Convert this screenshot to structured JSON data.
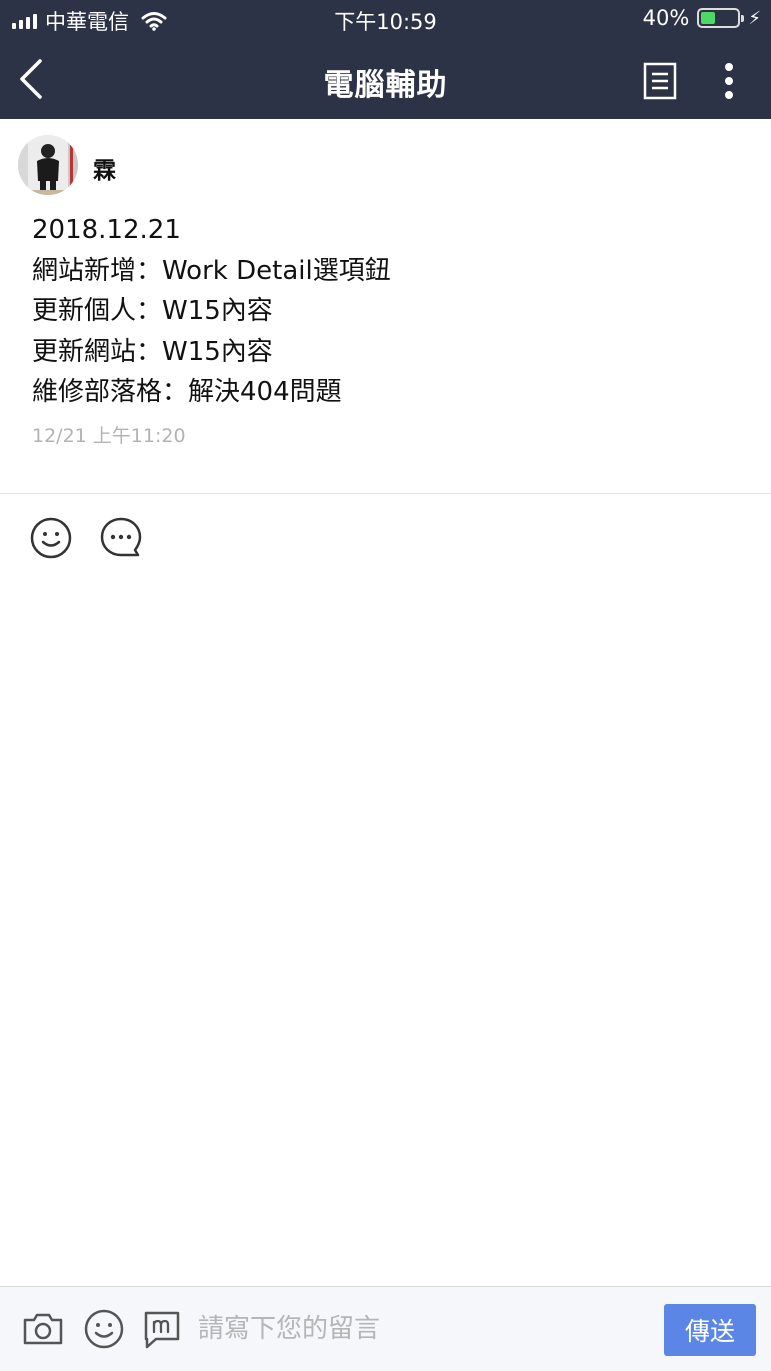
{
  "status_bar": {
    "carrier": "中華電信",
    "time": "下午10:59",
    "battery": "40%",
    "battery_level": 0.4,
    "wifi_icon": "wifi-icon",
    "charging_icon": "bolt-icon"
  },
  "nav": {
    "title": "電腦輔助",
    "back_icon": "chevron-left-icon",
    "notes_icon": "notes-icon",
    "more_icon": "more-vertical-icon"
  },
  "post": {
    "author": "霖",
    "lines": [
      "2018.12.21",
      "網站新增：Work Detail選項鈕",
      "更新個人：W15內容",
      "更新網站：W15內容",
      "維修部落格：解決404問題"
    ],
    "timestamp": "12/21 上午11:20"
  },
  "actions": {
    "reaction_icon": "smiley-icon",
    "comment_icon": "speech-bubble-icon"
  },
  "comment_bar": {
    "placeholder": "請寫下您的留言",
    "send_label": "傳送"
  },
  "colors": {
    "header_bg": "#2c3346",
    "send_button": "#5b86e5",
    "timestamp": "#b3b3b3"
  }
}
